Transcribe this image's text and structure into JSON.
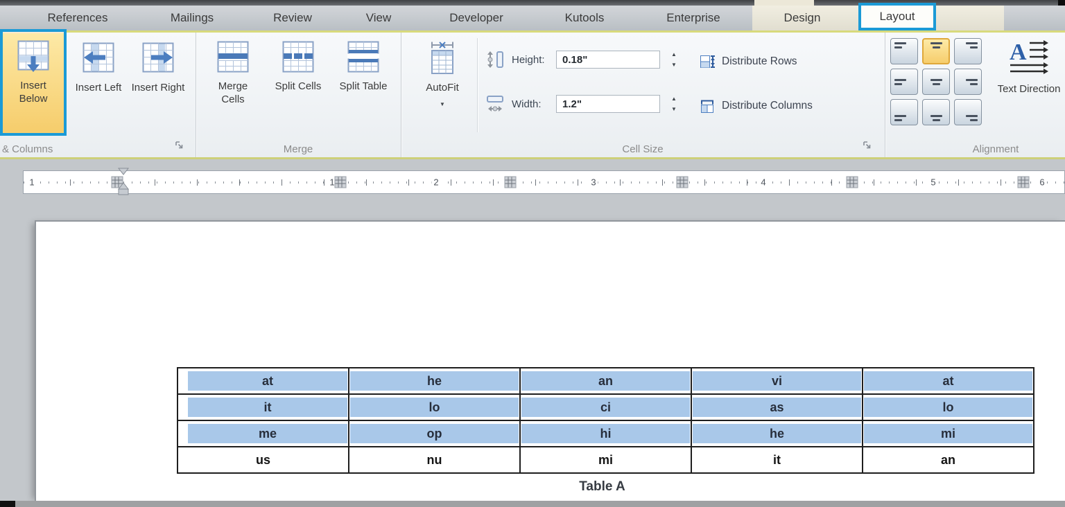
{
  "tabs": [
    "References",
    "Mailings",
    "Review",
    "View",
    "Developer",
    "Kutools",
    "Enterprise",
    "Design",
    "Layout"
  ],
  "ribbon": {
    "rows_columns": {
      "label": "& Columns",
      "insert_below": "Insert Below",
      "insert_left": "Insert Left",
      "insert_right": "Insert Right"
    },
    "merge": {
      "label": "Merge",
      "merge_cells": "Merge Cells",
      "split_cells": "Split Cells",
      "split_table": "Split Table"
    },
    "cell_size": {
      "label": "Cell Size",
      "autofit": "AutoFit",
      "height_label": "Height:",
      "height_value": "0.18\"",
      "width_label": "Width:",
      "width_value": "1.2\"",
      "distribute_rows": "Distribute Rows",
      "distribute_columns": "Distribute Columns"
    },
    "alignment": {
      "label": "Alignment",
      "text_direction": "Text Direction"
    }
  },
  "icons": {
    "dropdown_arrow": "▼",
    "spin_up": "▲",
    "spin_down": "▼"
  },
  "ruler": {
    "numbers": [
      "1",
      "1",
      "2",
      "3",
      "4",
      "5",
      "6"
    ]
  },
  "document": {
    "table": {
      "rows": [
        [
          "at",
          "he",
          "an",
          "vi",
          "at"
        ],
        [
          "it",
          "lo",
          "ci",
          "as",
          "lo"
        ],
        [
          "me",
          "op",
          "hi",
          "he",
          "mi"
        ],
        [
          "us",
          "nu",
          "mi",
          "it",
          "an"
        ]
      ],
      "selected_row_count": 3,
      "caption": "Table A"
    }
  },
  "colors": {
    "annotation_blue": "#1b9ad6",
    "selection_blue": "#a9c8e9",
    "highlight_yellow": "#f6cd6c",
    "ribbon_accent_line": "#d8da7c"
  }
}
